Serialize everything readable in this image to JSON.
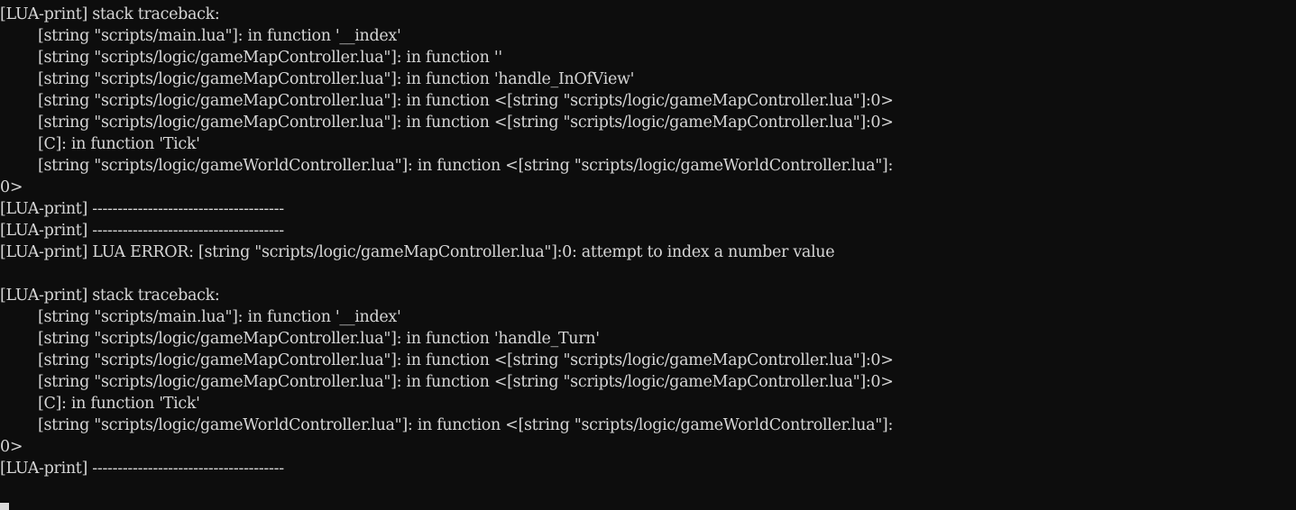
{
  "terminal": {
    "title": "LUA console output",
    "background_color": "#0d0d0d",
    "text_color": "#d6d6d6",
    "cursor_color": "#dcdcdc",
    "font_size_px": 17.5,
    "line_height_px": 24,
    "columns": 124,
    "rows": 23,
    "prefix": "[LUA-print]",
    "separator": "--------------------------------------",
    "cursor": {
      "name": "text-cursor",
      "visible": true,
      "column": 0,
      "row": 23
    },
    "lines": [
      "[LUA-print] stack traceback:",
      "        [string \"scripts/main.lua\"]: in function '__index'",
      "        [string \"scripts/logic/gameMapController.lua\"]: in function ''",
      "        [string \"scripts/logic/gameMapController.lua\"]: in function 'handle_InOfView'",
      "        [string \"scripts/logic/gameMapController.lua\"]: in function <[string \"scripts/logic/gameMapController.lua\"]:0>",
      "        [string \"scripts/logic/gameMapController.lua\"]: in function <[string \"scripts/logic/gameMapController.lua\"]:0>",
      "        [C]: in function 'Tick'",
      "        [string \"scripts/logic/gameWorldController.lua\"]: in function <[string \"scripts/logic/gameWorldController.lua\"]:",
      "0>",
      "[LUA-print] --------------------------------------",
      "[LUA-print] --------------------------------------",
      "[LUA-print] LUA ERROR: [string \"scripts/logic/gameMapController.lua\"]:0: attempt to index a number value",
      "",
      "[LUA-print] stack traceback:",
      "        [string \"scripts/main.lua\"]: in function '__index'",
      "        [string \"scripts/logic/gameMapController.lua\"]: in function 'handle_Turn'",
      "        [string \"scripts/logic/gameMapController.lua\"]: in function <[string \"scripts/logic/gameMapController.lua\"]:0>",
      "        [string \"scripts/logic/gameMapController.lua\"]: in function <[string \"scripts/logic/gameMapController.lua\"]:0>",
      "        [C]: in function 'Tick'",
      "        [string \"scripts/logic/gameWorldController.lua\"]: in function <[string \"scripts/logic/gameWorldController.lua\"]:",
      "0>",
      "[LUA-print] --------------------------------------",
      ""
    ]
  }
}
